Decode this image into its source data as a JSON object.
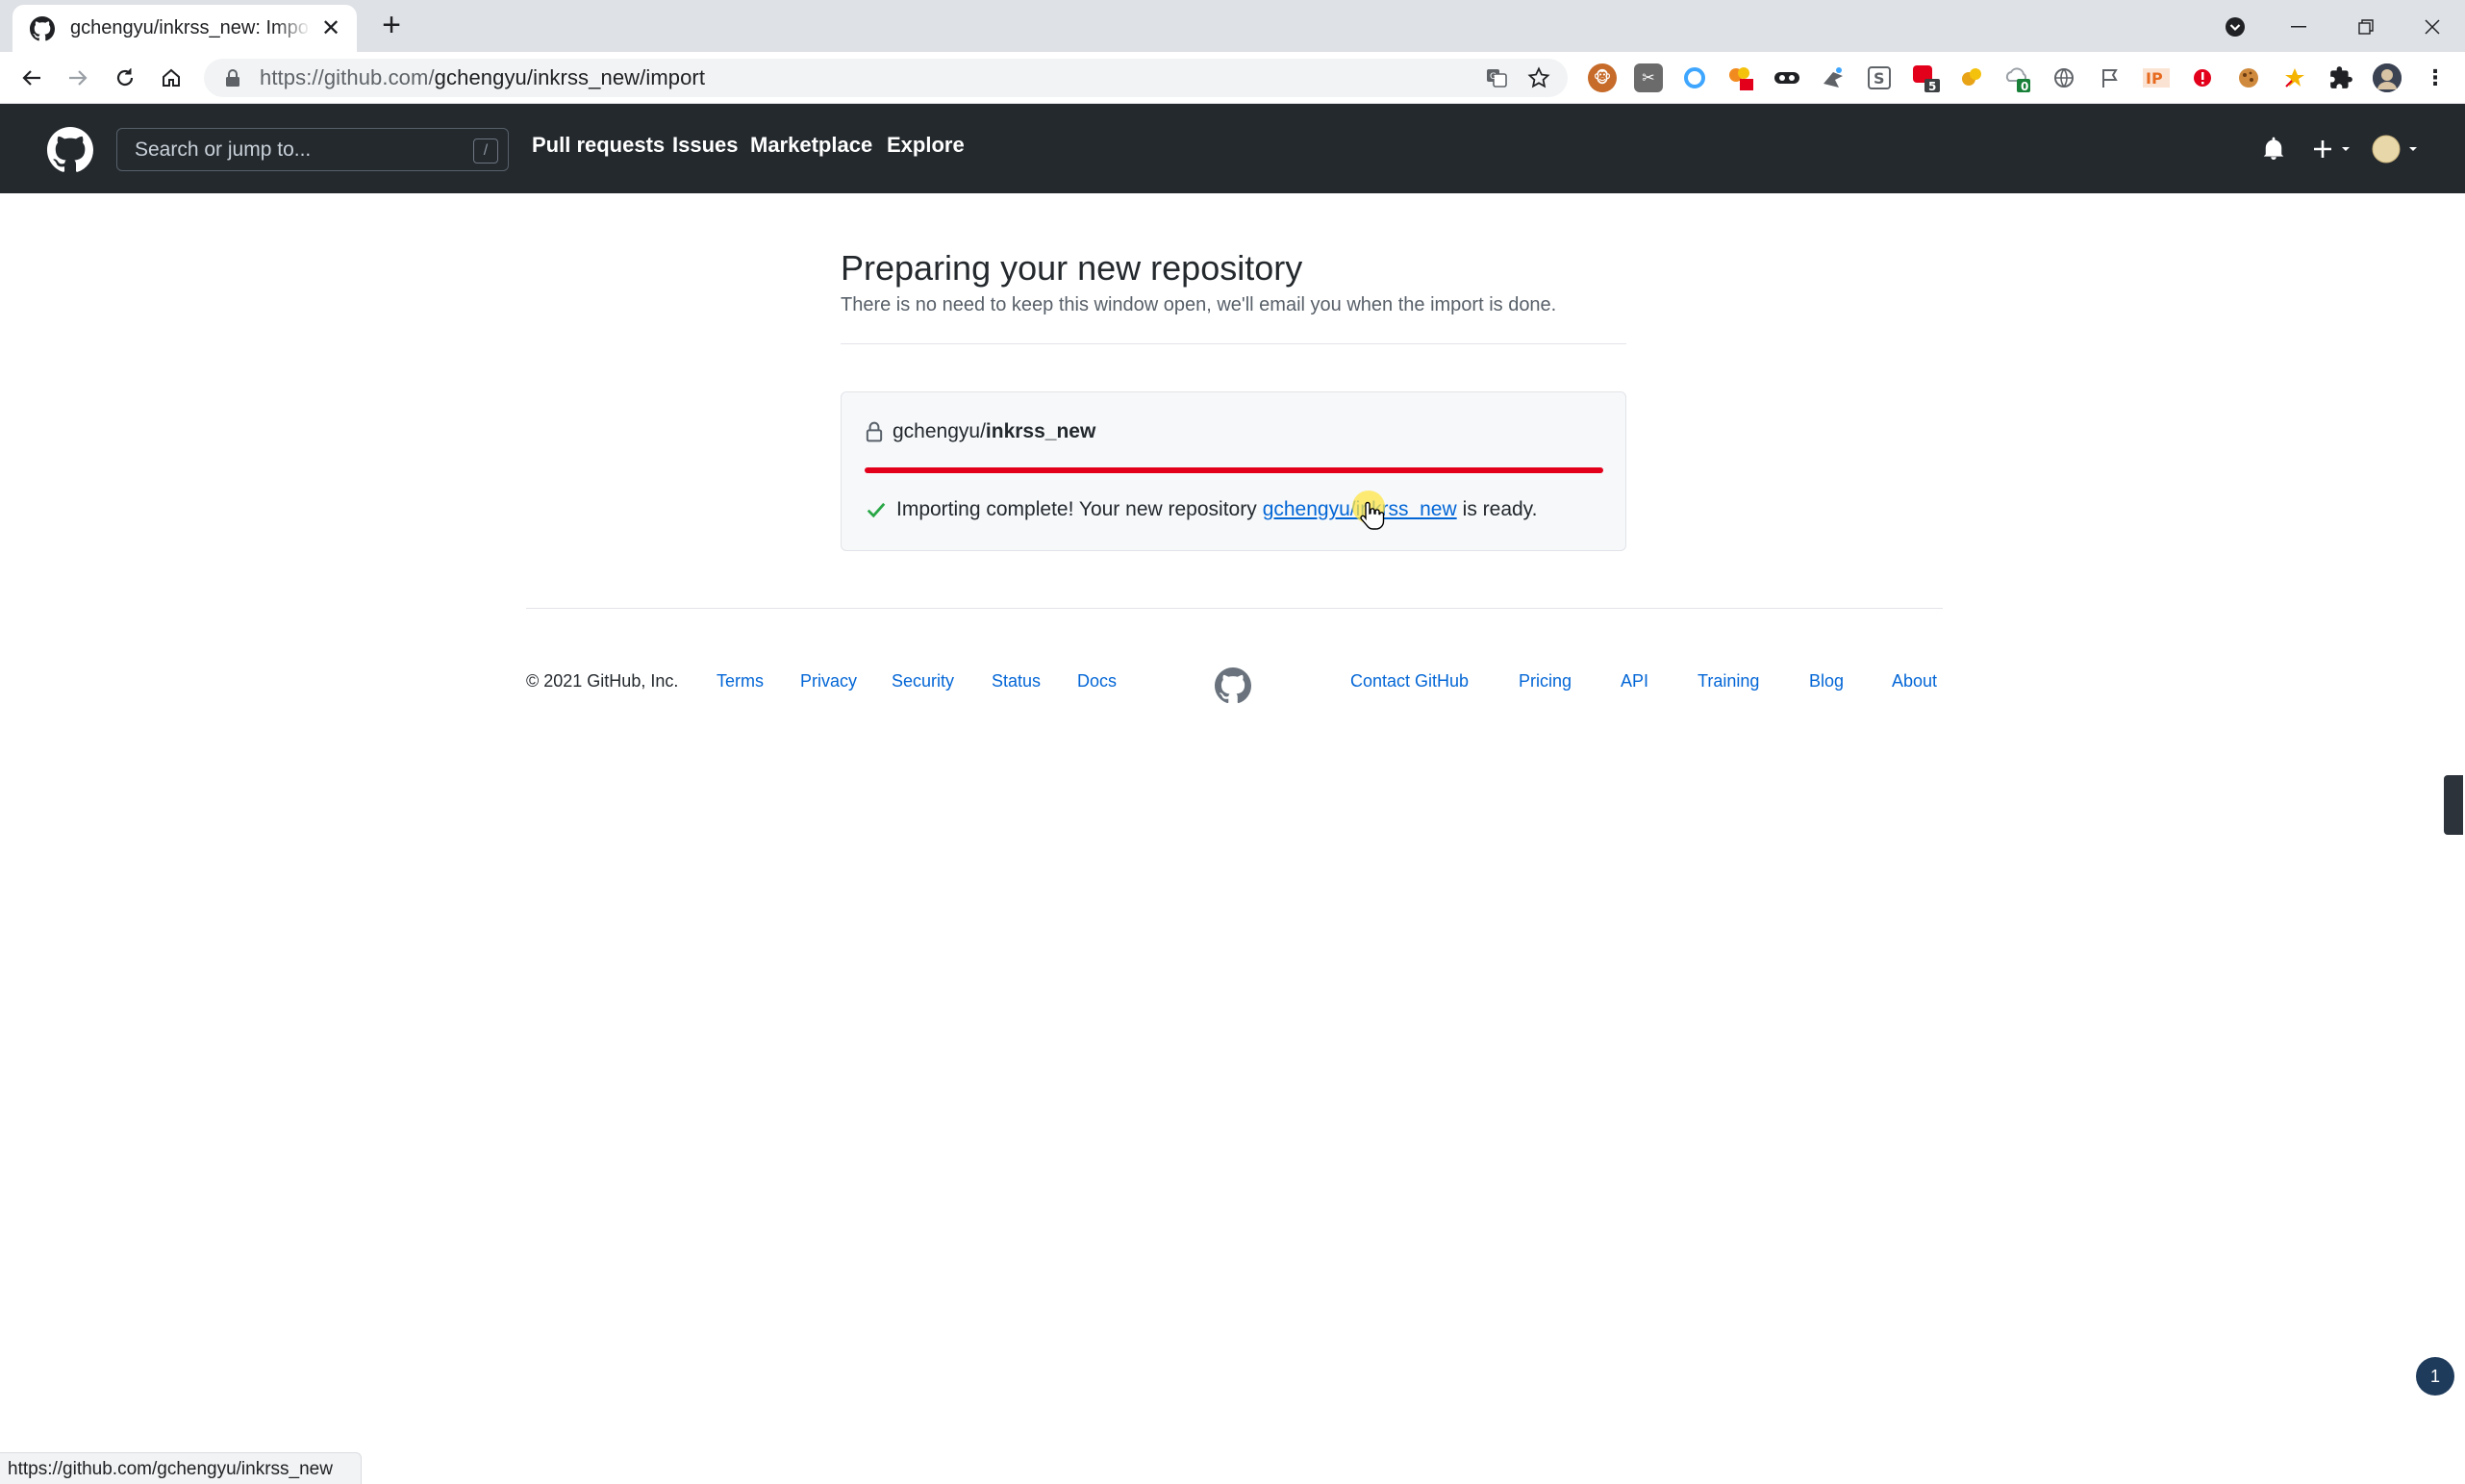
{
  "browser": {
    "tab_title": "gchengyu/inkrss_new: Importi",
    "url_host": "https://github.com/",
    "url_path": "gchengyu/inkrss_new/import",
    "extension_badges": [
      "5",
      "0"
    ],
    "status_url": "https://github.com/gchengyu/inkrss_new"
  },
  "header": {
    "search_placeholder": "Search or jump to...",
    "search_shortcut": "/",
    "nav": [
      "Pull requests",
      "Issues",
      "Marketplace",
      "Explore"
    ]
  },
  "main": {
    "title": "Preparing your new repository",
    "subtitle": "There is no need to keep this window open, we'll email you when the import is done.",
    "repo_owner": "gchengyu/",
    "repo_name": "inkrss_new",
    "progress_fraction": 1.0,
    "progress_color": "#e3001b",
    "status_prefix": "Importing complete! Your new repository",
    "status_link": "gchengyu/inkrss_new",
    "status_suffix": "is ready."
  },
  "footer": {
    "copyright": "© 2021 GitHub, Inc.",
    "left_links": [
      "Terms",
      "Privacy",
      "Security",
      "Status",
      "Docs"
    ],
    "right_links": [
      "Contact GitHub",
      "Pricing",
      "API",
      "Training",
      "Blog",
      "About"
    ]
  },
  "notification_count": "1",
  "colors": {
    "header_bg": "#24292e",
    "link": "#0366d6",
    "check": "#28a745"
  }
}
